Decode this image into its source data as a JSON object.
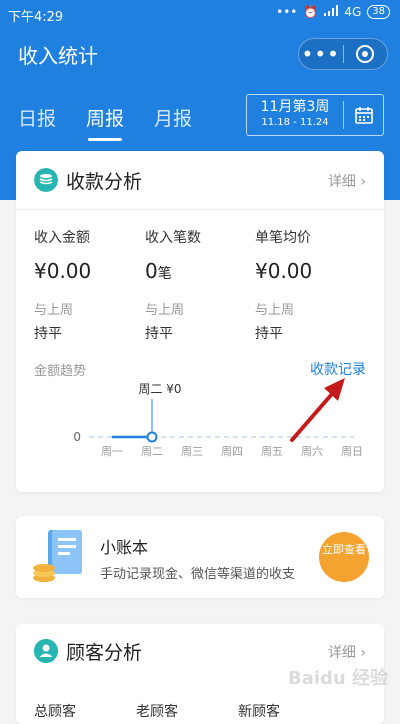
{
  "status_bar": {
    "time": "下午4:29",
    "network": "4G",
    "battery": "38"
  },
  "header": {
    "title": "收入统计",
    "more_label": "•••"
  },
  "tabs": [
    {
      "label": "日报",
      "active": false
    },
    {
      "label": "周报",
      "active": true
    },
    {
      "label": "月报",
      "active": false
    }
  ],
  "week_selector": {
    "label": "11月第3周",
    "range": "11.18 - 11.24"
  },
  "collection_card": {
    "title": "收款分析",
    "detail": "详细",
    "stats": [
      {
        "label": "收入金额",
        "value": "¥0.00",
        "unit": "",
        "compare_label": "与上周",
        "compare_value": "持平"
      },
      {
        "label": "收入笔数",
        "value": "0",
        "unit": "笔",
        "compare_label": "与上周",
        "compare_value": "持平"
      },
      {
        "label": "单笔均价",
        "value": "¥0.00",
        "unit": "",
        "compare_label": "与上周",
        "compare_value": "持平"
      }
    ],
    "trend_label": "金额趋势",
    "records_link": "收款记录",
    "chart_data": {
      "type": "line",
      "categories": [
        "周一",
        "周二",
        "周三",
        "周四",
        "周五",
        "周六",
        "周日"
      ],
      "values": [
        0,
        0,
        null,
        null,
        null,
        null,
        null
      ],
      "y_tick": "0",
      "highlight": {
        "index": 1,
        "label": "周二 ¥0"
      }
    }
  },
  "ledger_card": {
    "title": "小账本",
    "description": "手动记录现金、微信等渠道的收支",
    "button": "立即查看"
  },
  "customer_card": {
    "title": "顾客分析",
    "detail": "详细",
    "columns": [
      "总顾客",
      "老顾客",
      "新顾客"
    ]
  },
  "watermark": "Baidu 经验",
  "colors": {
    "primary": "#1f80df",
    "arrow": "#c41a1a",
    "button": "#f4a331",
    "teal": "#26b5b0"
  }
}
